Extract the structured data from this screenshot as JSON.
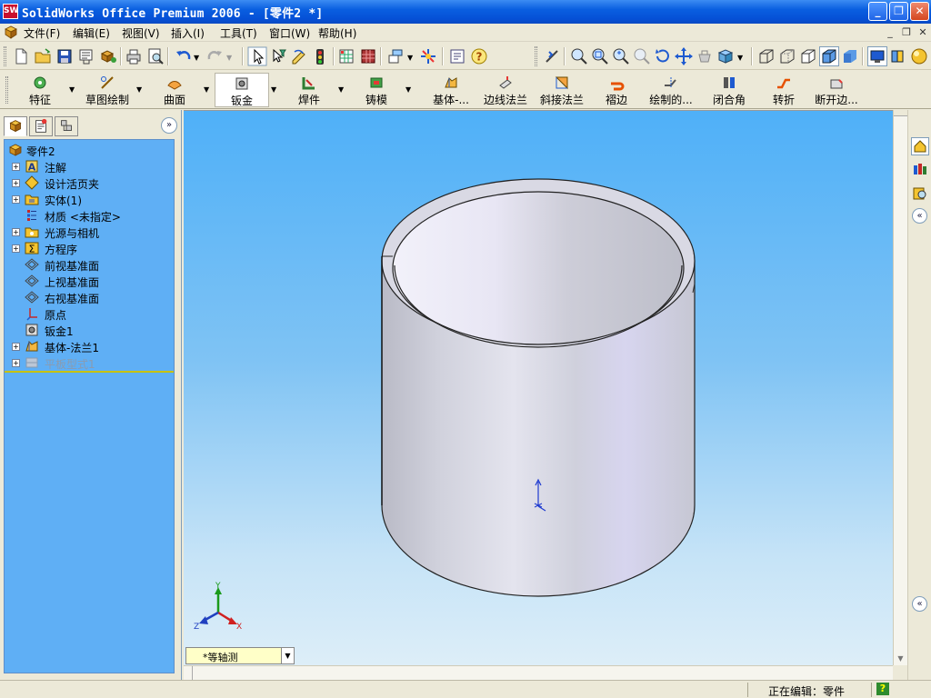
{
  "window": {
    "title": "SolidWorks Office Premium 2006 - [零件2 *]",
    "app_icon_text": "SW",
    "minimize_glyph": "_",
    "restore_glyph": "❐",
    "close_glyph": "✕"
  },
  "menubar": {
    "items": [
      "文件(F)",
      "编辑(E)",
      "视图(V)",
      "插入(I)",
      "工具(T)",
      "窗口(W)",
      "帮助(H)"
    ],
    "doc_min_glyph": "_",
    "doc_restore_glyph": "❐",
    "doc_close_glyph": "✕"
  },
  "feature_toolbar": {
    "buttons": [
      "特征",
      "草图绘制",
      "曲面",
      "钣金",
      "焊件",
      "铸模",
      "基体-...",
      "边线法兰",
      "斜接法兰",
      "褶边",
      "绘制的...",
      "闭合角",
      "转折",
      "断开边..."
    ],
    "active": "钣金"
  },
  "feature_tree": {
    "root": "零件2",
    "items": [
      {
        "label": "注解",
        "expandable": true,
        "icon": "annotation-icon"
      },
      {
        "label": "设计活页夹",
        "expandable": true,
        "icon": "design-binder-icon"
      },
      {
        "label": "实体(1)",
        "expandable": true,
        "icon": "solid-bodies-icon"
      },
      {
        "label": "材质 <未指定>",
        "expandable": false,
        "icon": "material-icon"
      },
      {
        "label": "光源与相机",
        "expandable": true,
        "icon": "lights-cameras-icon"
      },
      {
        "label": "方程序",
        "expandable": true,
        "icon": "equations-icon"
      },
      {
        "label": "前视基准面",
        "expandable": false,
        "icon": "plane-icon"
      },
      {
        "label": "上视基准面",
        "expandable": false,
        "icon": "plane-icon"
      },
      {
        "label": "右视基准面",
        "expandable": false,
        "icon": "plane-icon"
      },
      {
        "label": "原点",
        "expandable": false,
        "icon": "origin-icon"
      },
      {
        "label": "钣金1",
        "expandable": false,
        "icon": "sheet-metal-icon"
      },
      {
        "label": "基体-法兰1",
        "expandable": true,
        "icon": "base-flange-icon"
      },
      {
        "label": "平板型式1",
        "expandable": true,
        "icon": "flat-pattern-icon",
        "suppressed": true
      }
    ]
  },
  "viewport": {
    "view_orientation": "*等轴测",
    "triad_labels": {
      "x": "X",
      "y": "Y",
      "z": "Z"
    }
  },
  "statusbar": {
    "status": "正在编辑：零件",
    "help_glyph": "?"
  },
  "colors": {
    "title_bar": "#0a5fe0",
    "tree_background": "#5faff5",
    "viewport_top": "#4fb0f8",
    "viewport_bottom": "#ddeef8",
    "part_body": "#cfd0dc",
    "rollback_bar": "#c8c200"
  }
}
